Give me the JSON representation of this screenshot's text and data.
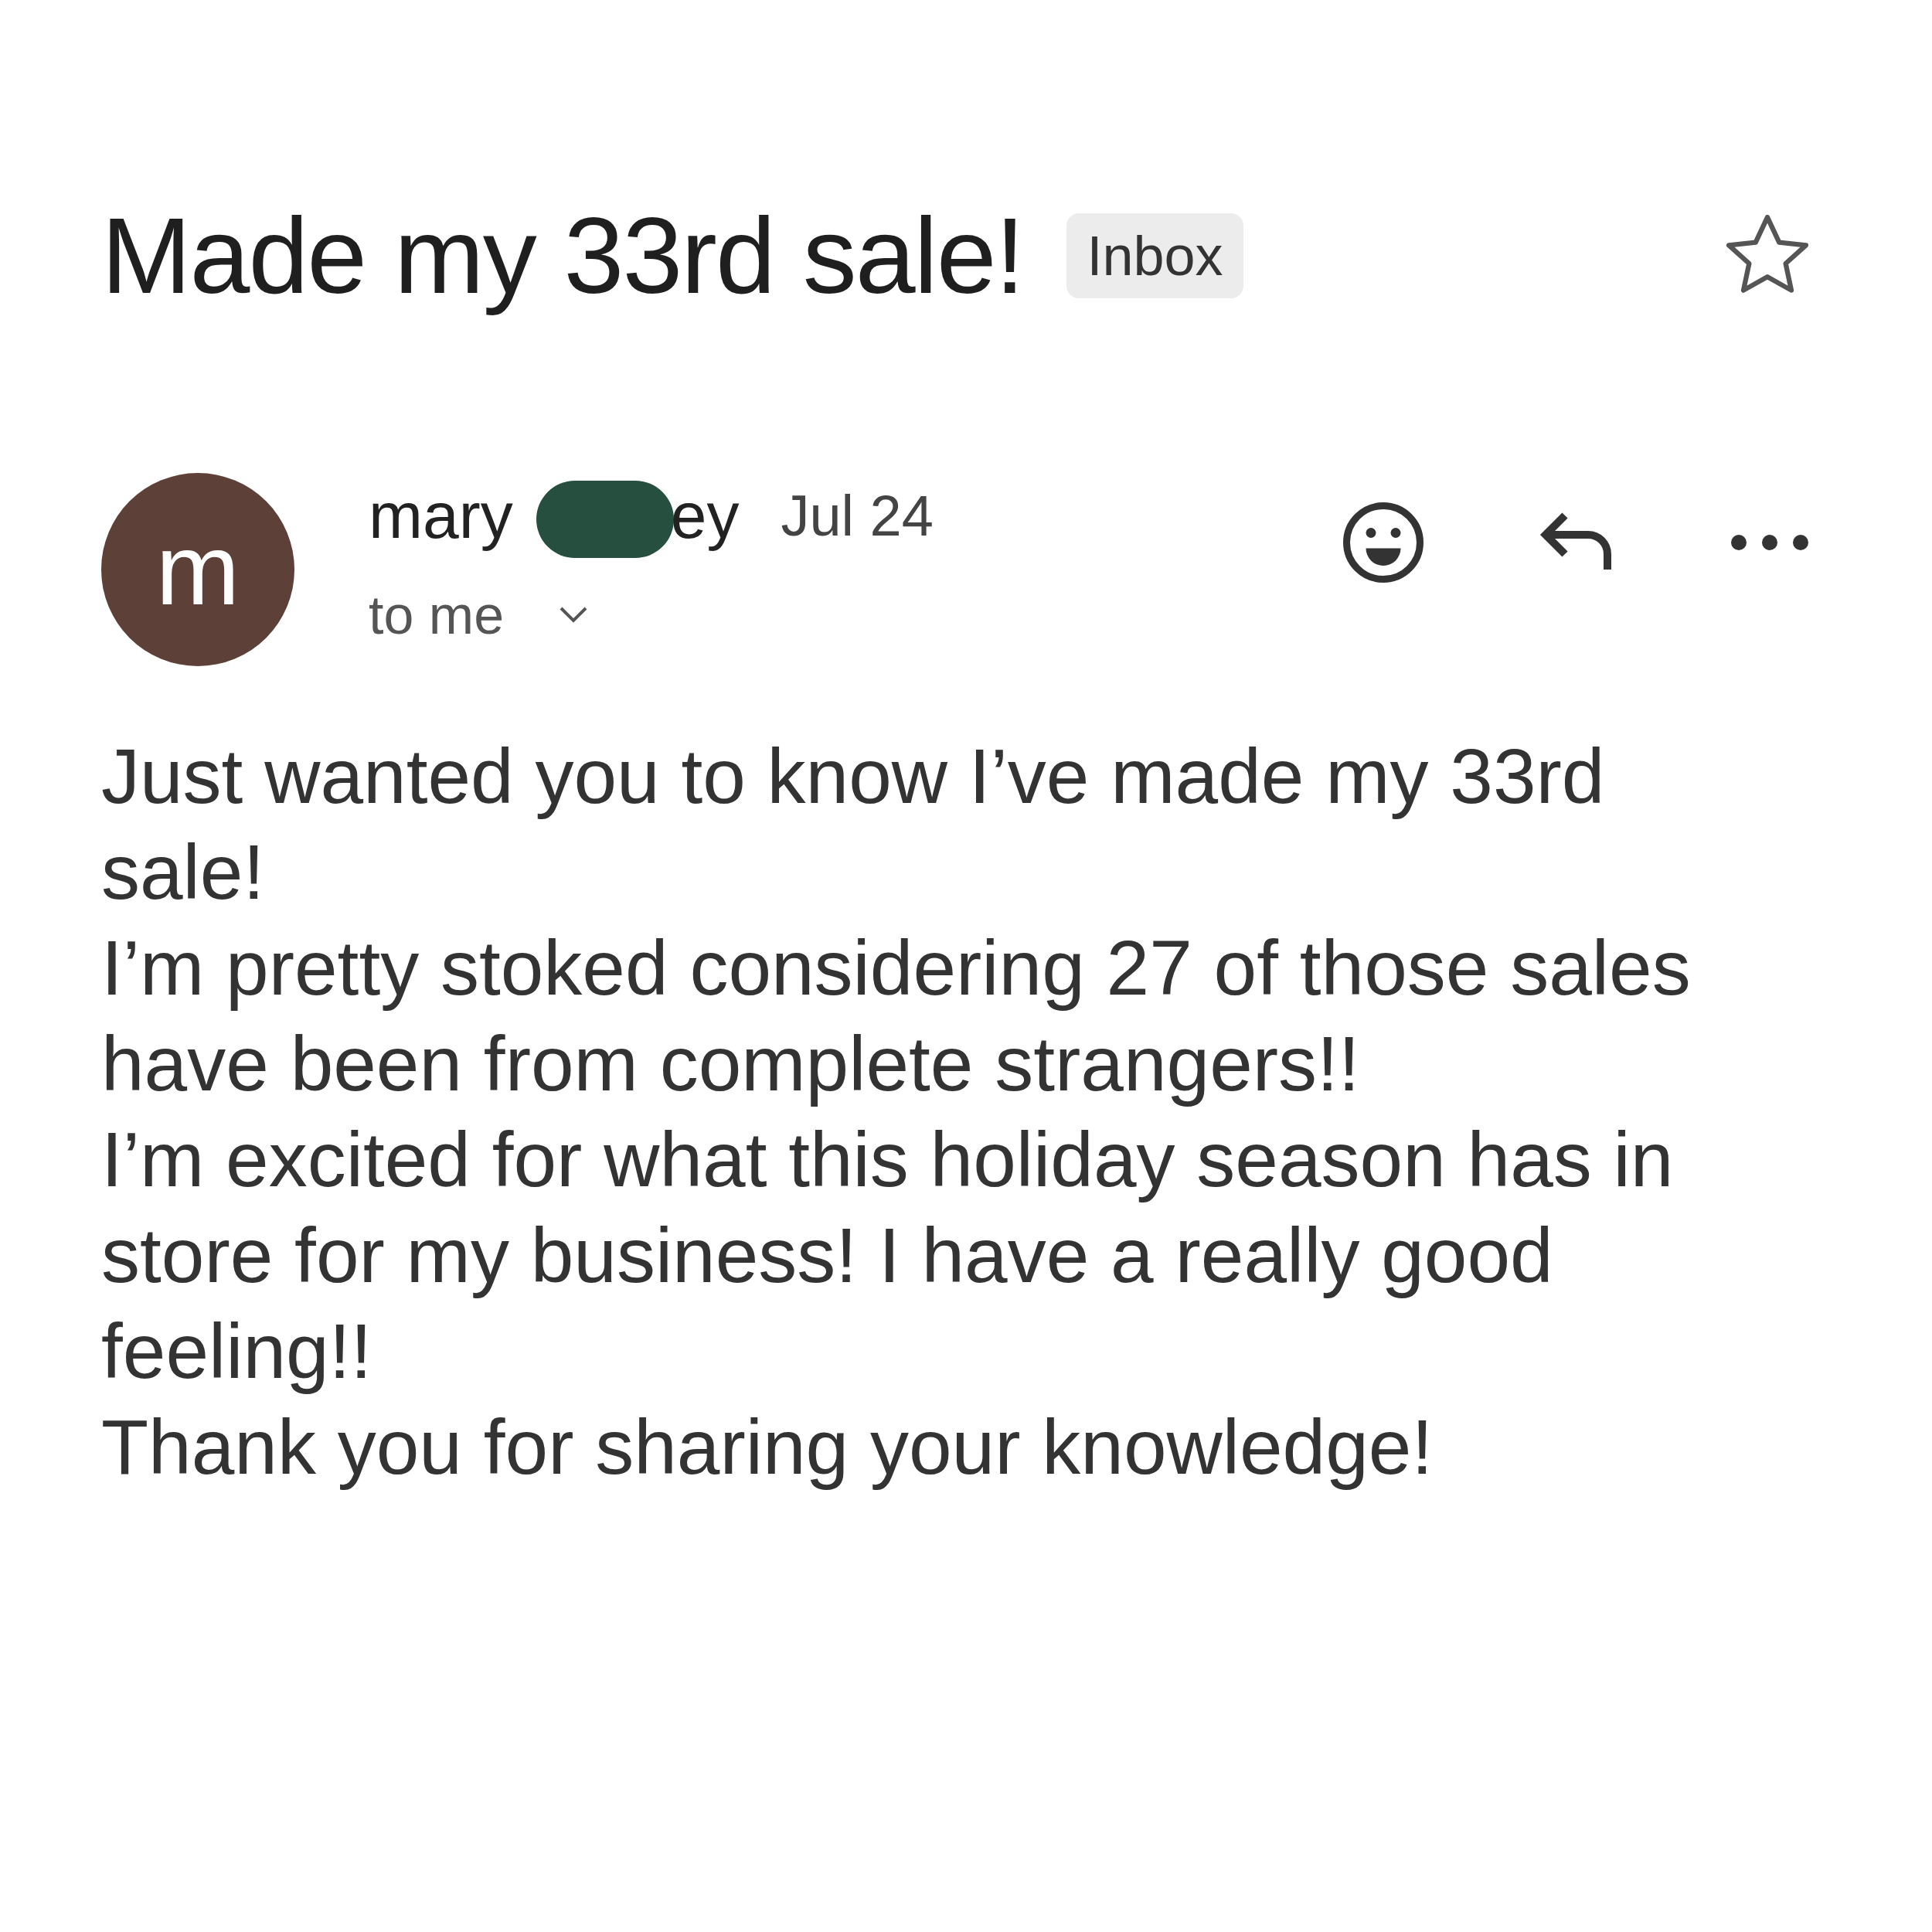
{
  "subject": {
    "title": "Made my 33rd sale!",
    "label": "Inbox",
    "starred": false
  },
  "sender": {
    "initial": "m",
    "name_start": "mary",
    "name_end": "ey",
    "date": "Jul 24",
    "recipient": "to me"
  },
  "body": [
    {
      "lines": [
        "Just wanted you to know I’ve made my 33rd",
        "sale!"
      ]
    },
    {
      "lines": [
        "I’m pretty stoked considering 27 of those sales",
        "have been from complete strangers!!"
      ]
    },
    {
      "lines": [
        "I’m excited for what this holiday season has in",
        "store for my business! I have a really good",
        "feeling!!"
      ]
    },
    {
      "lines": [
        "Thank you for sharing your knowledge!"
      ]
    }
  ]
}
